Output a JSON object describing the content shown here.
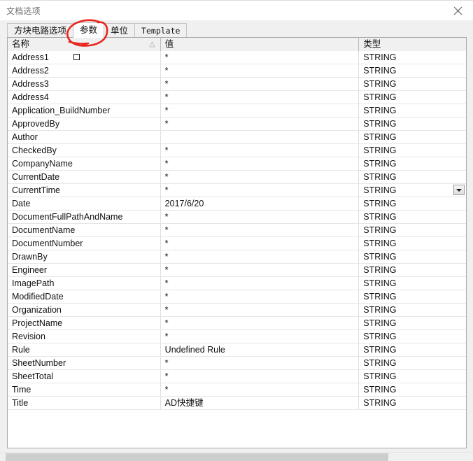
{
  "window": {
    "title": "文档选项",
    "close_icon": "close-icon"
  },
  "tabs": [
    {
      "label": "方块电路选项",
      "active": false,
      "script": "cjk"
    },
    {
      "label": "参数",
      "active": true,
      "script": "cjk"
    },
    {
      "label": "单位",
      "active": false,
      "script": "cjk"
    },
    {
      "label": "Template",
      "active": false,
      "script": "latin"
    }
  ],
  "grid": {
    "columns": [
      {
        "label": "名称",
        "sort_indicator": "sort-ascending-icon"
      },
      {
        "label": "值",
        "sort_indicator": ""
      },
      {
        "label": "类型",
        "sort_indicator": ""
      }
    ],
    "rows": [
      {
        "name": "Address1",
        "value": "*",
        "type": "STRING",
        "marker": true,
        "dropdown": false
      },
      {
        "name": "Address2",
        "value": "*",
        "type": "STRING",
        "marker": false,
        "dropdown": false
      },
      {
        "name": "Address3",
        "value": "*",
        "type": "STRING",
        "marker": false,
        "dropdown": false
      },
      {
        "name": "Address4",
        "value": "*",
        "type": "STRING",
        "marker": false,
        "dropdown": false
      },
      {
        "name": "Application_BuildNumber",
        "value": "*",
        "type": "STRING",
        "marker": false,
        "dropdown": false
      },
      {
        "name": "ApprovedBy",
        "value": "*",
        "type": "STRING",
        "marker": false,
        "dropdown": false
      },
      {
        "name": "Author",
        "value": "",
        "type": "STRING",
        "marker": false,
        "dropdown": false
      },
      {
        "name": "CheckedBy",
        "value": "*",
        "type": "STRING",
        "marker": false,
        "dropdown": false
      },
      {
        "name": "CompanyName",
        "value": "*",
        "type": "STRING",
        "marker": false,
        "dropdown": false
      },
      {
        "name": "CurrentDate",
        "value": "*",
        "type": "STRING",
        "marker": false,
        "dropdown": false
      },
      {
        "name": "CurrentTime",
        "value": "*",
        "type": "STRING",
        "marker": false,
        "dropdown": true
      },
      {
        "name": "Date",
        "value": "2017/6/20",
        "type": "STRING",
        "marker": false,
        "dropdown": false
      },
      {
        "name": "DocumentFullPathAndName",
        "value": "*",
        "type": "STRING",
        "marker": false,
        "dropdown": false
      },
      {
        "name": "DocumentName",
        "value": "*",
        "type": "STRING",
        "marker": false,
        "dropdown": false
      },
      {
        "name": "DocumentNumber",
        "value": "*",
        "type": "STRING",
        "marker": false,
        "dropdown": false
      },
      {
        "name": "DrawnBy",
        "value": "*",
        "type": "STRING",
        "marker": false,
        "dropdown": false
      },
      {
        "name": "Engineer",
        "value": "*",
        "type": "STRING",
        "marker": false,
        "dropdown": false
      },
      {
        "name": "ImagePath",
        "value": "*",
        "type": "STRING",
        "marker": false,
        "dropdown": false
      },
      {
        "name": "ModifiedDate",
        "value": "*",
        "type": "STRING",
        "marker": false,
        "dropdown": false
      },
      {
        "name": "Organization",
        "value": "*",
        "type": "STRING",
        "marker": false,
        "dropdown": false
      },
      {
        "name": "ProjectName",
        "value": "*",
        "type": "STRING",
        "marker": false,
        "dropdown": false
      },
      {
        "name": "Revision",
        "value": "*",
        "type": "STRING",
        "marker": false,
        "dropdown": false
      },
      {
        "name": "Rule",
        "value": "Undefined Rule",
        "type": "STRING",
        "marker": false,
        "dropdown": false
      },
      {
        "name": "SheetNumber",
        "value": "*",
        "type": "STRING",
        "marker": false,
        "dropdown": false
      },
      {
        "name": "SheetTotal",
        "value": "*",
        "type": "STRING",
        "marker": false,
        "dropdown": false
      },
      {
        "name": "Time",
        "value": "*",
        "type": "STRING",
        "marker": false,
        "dropdown": false
      },
      {
        "name": "Title",
        "value": "AD快捷键",
        "type": "STRING",
        "marker": false,
        "dropdown": false
      }
    ]
  },
  "annotation": {
    "color": "#e8251f",
    "shape": "hand-drawn-ellipse-around-tab"
  },
  "colors": {
    "dialog_background": "#f0f0f0",
    "grid_background": "#ffffff",
    "header_background": "#f0f0f0",
    "border": "#a8a8a8",
    "text": "#1a1a1a",
    "title_text": "#6b6b6b",
    "annotation_red": "#e8251f"
  }
}
